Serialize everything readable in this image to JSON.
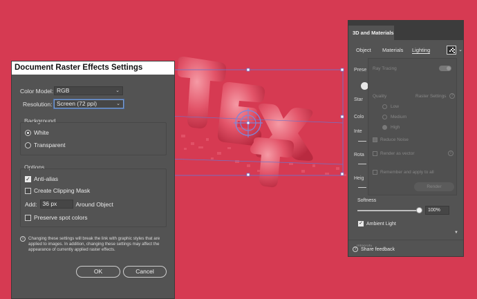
{
  "raster_dialog": {
    "title": "Document Raster Effects Settings",
    "color_model_label": "Color Model:",
    "color_model_value": "RGB",
    "resolution_label": "Resolution:",
    "resolution_value": "Screen (72 ppi)",
    "background_title": "Background",
    "background_white": "White",
    "background_transparent": "Transparent",
    "options_title": "Options",
    "anti_alias": "Anti-alias",
    "clipping_mask": "Create Clipping Mask",
    "add_label": "Add:",
    "add_value": "36 px",
    "around_object": "Around Object",
    "preserve_spot": "Preserve spot colors",
    "note": "Changing these settings will break the link with graphic styles that are applied to images. In addition, changing these settings may affect the appearance of currently applied raster effects.",
    "ok_label": "OK",
    "cancel_label": "Cancel"
  },
  "panel": {
    "title": "3D and Materials",
    "tab_object": "Object",
    "tab_materials": "Materials",
    "tab_lighting": "Lighting",
    "side_preset": "Prese",
    "side_star": "Star",
    "side_color": "Colo",
    "side_intensity": "Inte",
    "side_rotation": "Rota",
    "side_height": "Heig",
    "ray_tracing": "Ray Tracing",
    "quality": "Quality",
    "raster_settings": "Raster Settings",
    "low": "Low",
    "medium": "Medium",
    "high": "High",
    "reduce_noise": "Reduce Noise",
    "render_as_vector": "Render as vector",
    "remember_apply": "Remember and apply to all",
    "render_btn": "Render",
    "softness": "Softness",
    "softness_value": "100%",
    "softness_fraction": 1.0,
    "ambient_light": "Ambient Light",
    "intensity_cut": "Intensity",
    "share_feedback": "Share feedback"
  },
  "artwork": {
    "text": "TEXT",
    "bg_color": "#d63a52",
    "letter_color": "#e25368"
  }
}
